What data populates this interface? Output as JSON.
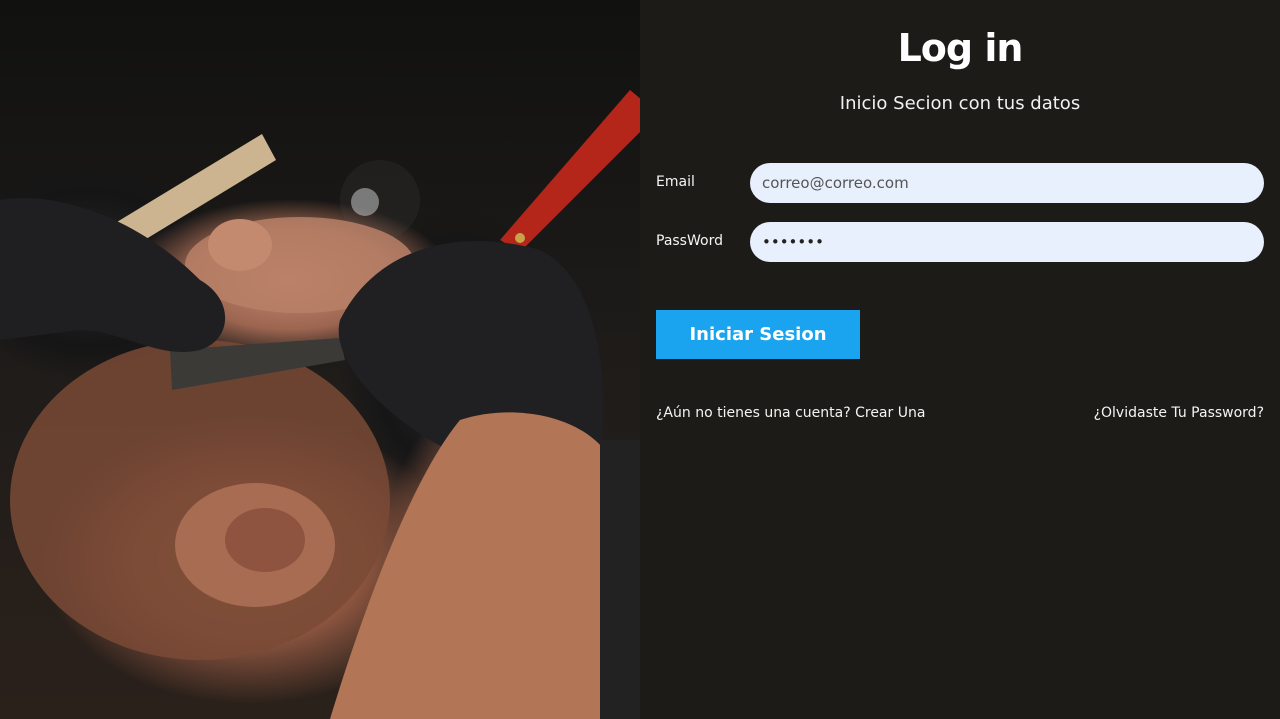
{
  "hero_image": {
    "description_icon": "barber-shaving-photo"
  },
  "login": {
    "title": "Log in",
    "subtitle": "Inicio Secion con tus datos",
    "email_label": "Email",
    "email_placeholder": "correo@correo.com",
    "password_label": "PassWord",
    "password_value": "•••••••",
    "submit_label": "Iniciar Sesion",
    "signup_link": "¿Aún no tienes una cuenta? Crear Una",
    "forgot_link": "¿Olvidaste Tu Password?"
  },
  "colors": {
    "panel_bg": "#1c1b17",
    "input_bg": "#e8f0fe",
    "button_bg": "#1aa3ef"
  }
}
